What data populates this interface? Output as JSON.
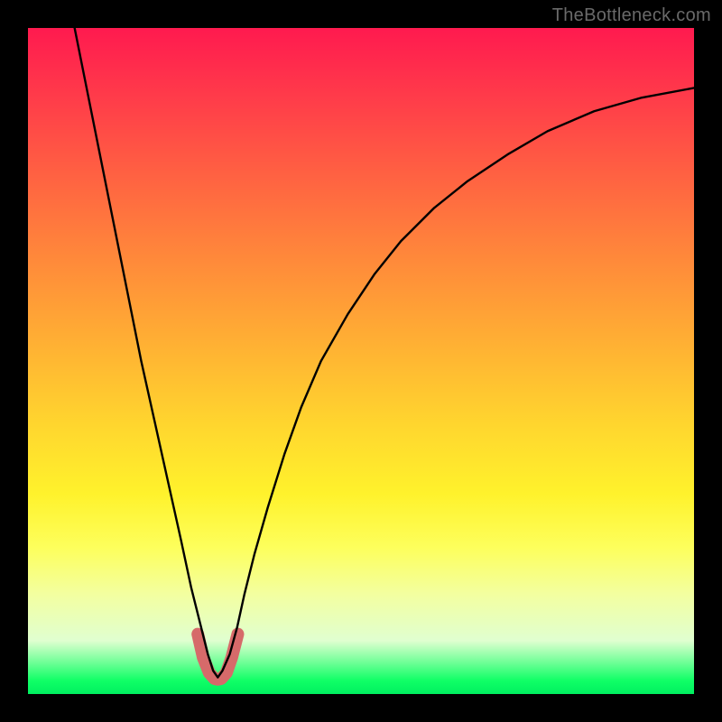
{
  "watermark": "TheBottleneck.com",
  "chart_data": {
    "type": "line",
    "title": "",
    "xlabel": "",
    "ylabel": "",
    "xlim": [
      0,
      100
    ],
    "ylim": [
      0,
      100
    ],
    "gradient_stops": [
      {
        "pct": 0,
        "color": "#ff1a4f"
      },
      {
        "pct": 10,
        "color": "#ff3a4a"
      },
      {
        "pct": 22,
        "color": "#ff6142"
      },
      {
        "pct": 35,
        "color": "#ff8a3a"
      },
      {
        "pct": 48,
        "color": "#ffb233"
      },
      {
        "pct": 60,
        "color": "#ffd72e"
      },
      {
        "pct": 70,
        "color": "#fff22c"
      },
      {
        "pct": 78,
        "color": "#fdff5c"
      },
      {
        "pct": 85,
        "color": "#f3ffa0"
      },
      {
        "pct": 92,
        "color": "#e0ffd0"
      },
      {
        "pct": 98,
        "color": "#10ff66"
      },
      {
        "pct": 100,
        "color": "#00f060"
      }
    ],
    "series": [
      {
        "name": "bottleneck-curve",
        "color": "#000000",
        "x": [
          7.0,
          9.0,
          11.0,
          13.0,
          15.0,
          17.0,
          19.0,
          21.0,
          23.0,
          24.5,
          26.0,
          27.0,
          27.8,
          28.5,
          29.2,
          30.3,
          31.4,
          32.5,
          34.0,
          36.0,
          38.5,
          41.0,
          44.0,
          48.0,
          52.0,
          56.0,
          61.0,
          66.0,
          72.0,
          78.0,
          85.0,
          92.0,
          100.0
        ],
        "y": [
          100.0,
          90.0,
          80.0,
          70.0,
          60.0,
          50.0,
          41.0,
          32.0,
          23.0,
          16.0,
          10.0,
          6.0,
          3.5,
          2.5,
          3.5,
          6.0,
          10.0,
          15.0,
          21.0,
          28.0,
          36.0,
          43.0,
          50.0,
          57.0,
          63.0,
          68.0,
          73.0,
          77.0,
          81.0,
          84.5,
          87.5,
          89.5,
          91.0
        ]
      },
      {
        "name": "trough-highlight",
        "color": "#d66a6a",
        "width": 14,
        "x": [
          25.5,
          26.3,
          27.2,
          28.0,
          28.5,
          29.0,
          29.8,
          30.6,
          31.5
        ],
        "y": [
          9.0,
          5.5,
          3.2,
          2.3,
          2.2,
          2.3,
          3.2,
          5.5,
          9.0
        ]
      }
    ]
  }
}
